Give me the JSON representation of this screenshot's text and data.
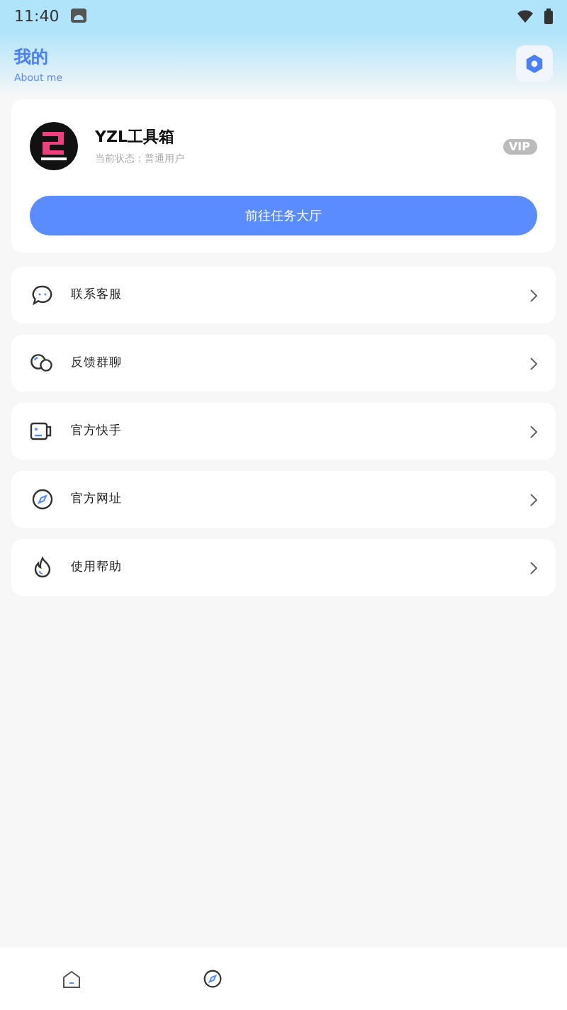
{
  "status_bar": {
    "time": "11:40"
  },
  "header": {
    "title": "我的",
    "subtitle": "About me"
  },
  "profile": {
    "name": "YZL工具箱",
    "status": "当前状态：普通用户",
    "badge": "VIP",
    "button": "前往任务大厅"
  },
  "menu": [
    {
      "kind": "chat",
      "label": "联系客服"
    },
    {
      "kind": "group",
      "label": "反馈群聊"
    },
    {
      "kind": "video",
      "label": "官方快手"
    },
    {
      "kind": "compass",
      "label": "官方网址"
    },
    {
      "kind": "flame",
      "label": "使用帮助"
    }
  ],
  "bottom_nav": [
    {
      "kind": "home"
    },
    {
      "kind": "compass"
    }
  ]
}
